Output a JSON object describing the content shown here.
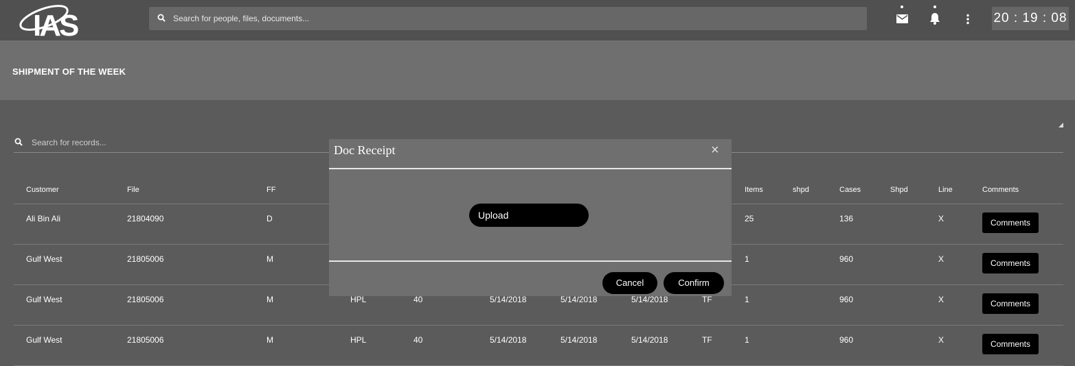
{
  "topbar": {
    "logo_text": "IAS",
    "search_placeholder": "Search for people, files, documents...",
    "clock": "20 : 19 : 08"
  },
  "page": {
    "title": "SHIPMENT OF THE WEEK"
  },
  "records_search": {
    "placeholder": "Search for records..."
  },
  "table": {
    "headers": [
      "Customer",
      "File",
      "FF",
      "",
      "",
      "",
      "",
      "",
      "",
      "Items",
      "shpd",
      "Cases",
      "Shpd",
      "Line",
      "Comments"
    ],
    "rows": [
      [
        "Ali Bin Ali",
        "21804090",
        "D",
        "",
        "",
        "",
        "",
        "",
        "",
        "25",
        "",
        "136",
        "",
        "X"
      ],
      [
        "Gulf West",
        "21805006",
        "M",
        "",
        "",
        "",
        "",
        "",
        "",
        "1",
        "",
        "960",
        "",
        "X"
      ],
      [
        "Gulf West",
        "21805006",
        "M",
        "HPL",
        "40",
        "5/14/2018",
        "5/14/2018",
        "5/14/2018",
        "TF",
        "1",
        "",
        "960",
        "",
        "X"
      ],
      [
        "Gulf West",
        "21805006",
        "M",
        "HPL",
        "40",
        "5/14/2018",
        "5/14/2018",
        "5/14/2018",
        "TF",
        "1",
        "",
        "960",
        "",
        "X"
      ]
    ],
    "comments_label": "Comments"
  },
  "modal": {
    "title": "Doc Receipt",
    "close_symbol": "×",
    "upload_label": "Upload",
    "cancel_label": "Cancel",
    "confirm_label": "Confirm"
  }
}
